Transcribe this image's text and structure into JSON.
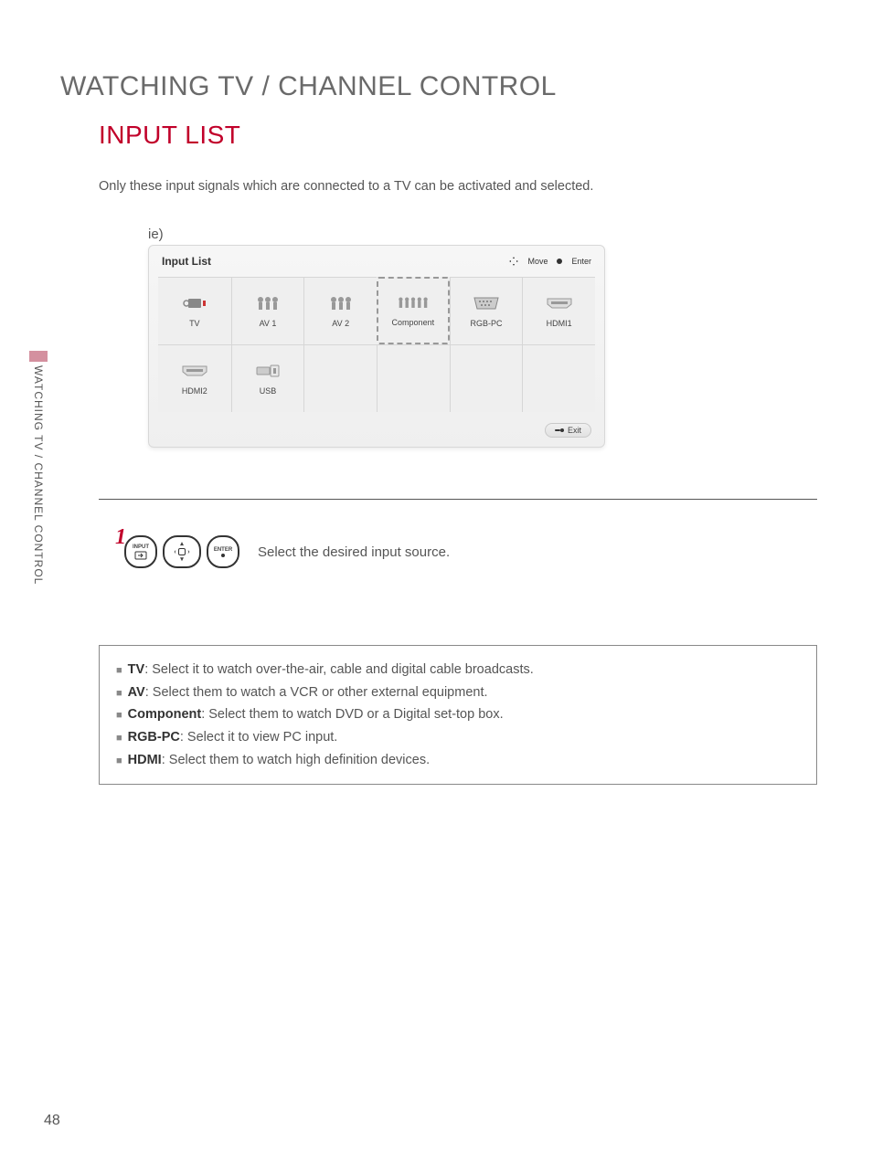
{
  "page": {
    "title": "WATCHING TV / CHANNEL CONTROL",
    "section": "INPUT LIST",
    "intro": "Only these input signals which are connected to a TV can be activated and selected.",
    "example_prefix": "ie)",
    "sidebar": "WATCHING TV / CHANNEL CONTROL",
    "number": "48"
  },
  "osd": {
    "title": "Input List",
    "hint_move": "Move",
    "hint_enter": "Enter",
    "exit": "Exit",
    "cells": [
      {
        "label": "TV",
        "icon": "tv"
      },
      {
        "label": "AV 1",
        "icon": "av"
      },
      {
        "label": "AV 2",
        "icon": "av"
      },
      {
        "label": "Component",
        "icon": "component",
        "selected": true
      },
      {
        "label": "RGB-PC",
        "icon": "vga"
      },
      {
        "label": "HDMI1",
        "icon": "hdmi"
      },
      {
        "label": "HDMI2",
        "icon": "hdmi"
      },
      {
        "label": "USB",
        "icon": "usb"
      }
    ]
  },
  "step": {
    "number": "1",
    "btn_input": "INPUT",
    "btn_enter_top": "ENTER",
    "instruction": "Select the desired input source."
  },
  "descriptions": [
    {
      "term": "TV",
      "text": ": Select it to watch over-the-air, cable and digital cable broadcasts."
    },
    {
      "term": "AV",
      "text": ": Select them to watch a VCR or other external equipment."
    },
    {
      "term": "Component",
      "text": ": Select them to watch DVD or a Digital set-top box."
    },
    {
      "term": "RGB-PC",
      "text": ": Select it to view PC input."
    },
    {
      "term": "HDMI",
      "text": ": Select them to watch high definition devices."
    }
  ]
}
